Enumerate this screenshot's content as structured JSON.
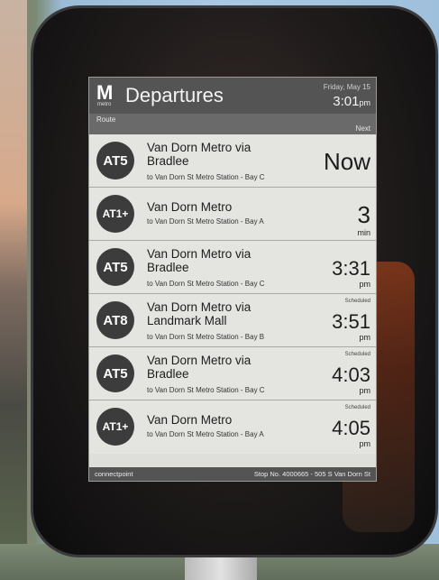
{
  "header": {
    "logo": "M",
    "logo_sub": "metro",
    "title": "Departures",
    "date": "Friday, May 15",
    "time": "3:01",
    "time_suffix": "pm"
  },
  "subheader": {
    "left": "Route",
    "right": "Next"
  },
  "departures": [
    {
      "route": "AT5",
      "line1": "Van Dorn Metro via",
      "line2": "Bradlee",
      "to": "to Van Dorn St Metro Station - Bay C",
      "tag": "",
      "eta": "Now",
      "unit": ""
    },
    {
      "route": "AT1+",
      "line1": "Van Dorn Metro",
      "line2": "",
      "to": "to Van Dorn St Metro Station - Bay A",
      "tag": "",
      "eta": "3",
      "unit": "min"
    },
    {
      "route": "AT5",
      "line1": "Van Dorn Metro via",
      "line2": "Bradlee",
      "to": "to Van Dorn St Metro Station - Bay C",
      "tag": "",
      "eta": "3:31",
      "unit": "pm"
    },
    {
      "route": "AT8",
      "line1": "Van Dorn Metro via",
      "line2": "Landmark Mall",
      "to": "to Van Dorn St Metro Station - Bay B",
      "tag": "Scheduled",
      "eta": "3:51",
      "unit": "pm"
    },
    {
      "route": "AT5",
      "line1": "Van Dorn Metro via",
      "line2": "Bradlee",
      "to": "to Van Dorn St Metro Station - Bay C",
      "tag": "Scheduled",
      "eta": "4:03",
      "unit": "pm"
    },
    {
      "route": "AT1+",
      "line1": "Van Dorn Metro",
      "line2": "",
      "to": "to Van Dorn St Metro Station - Bay A",
      "tag": "Scheduled",
      "eta": "4:05",
      "unit": "pm"
    }
  ],
  "footer": {
    "brand": "connectpoint",
    "stop": "Stop No. 4000665 - 505 S Van Dorn St"
  },
  "colors": {
    "badge": "#3c3c3d",
    "header": "#545455",
    "screen": "#dedfdb"
  }
}
